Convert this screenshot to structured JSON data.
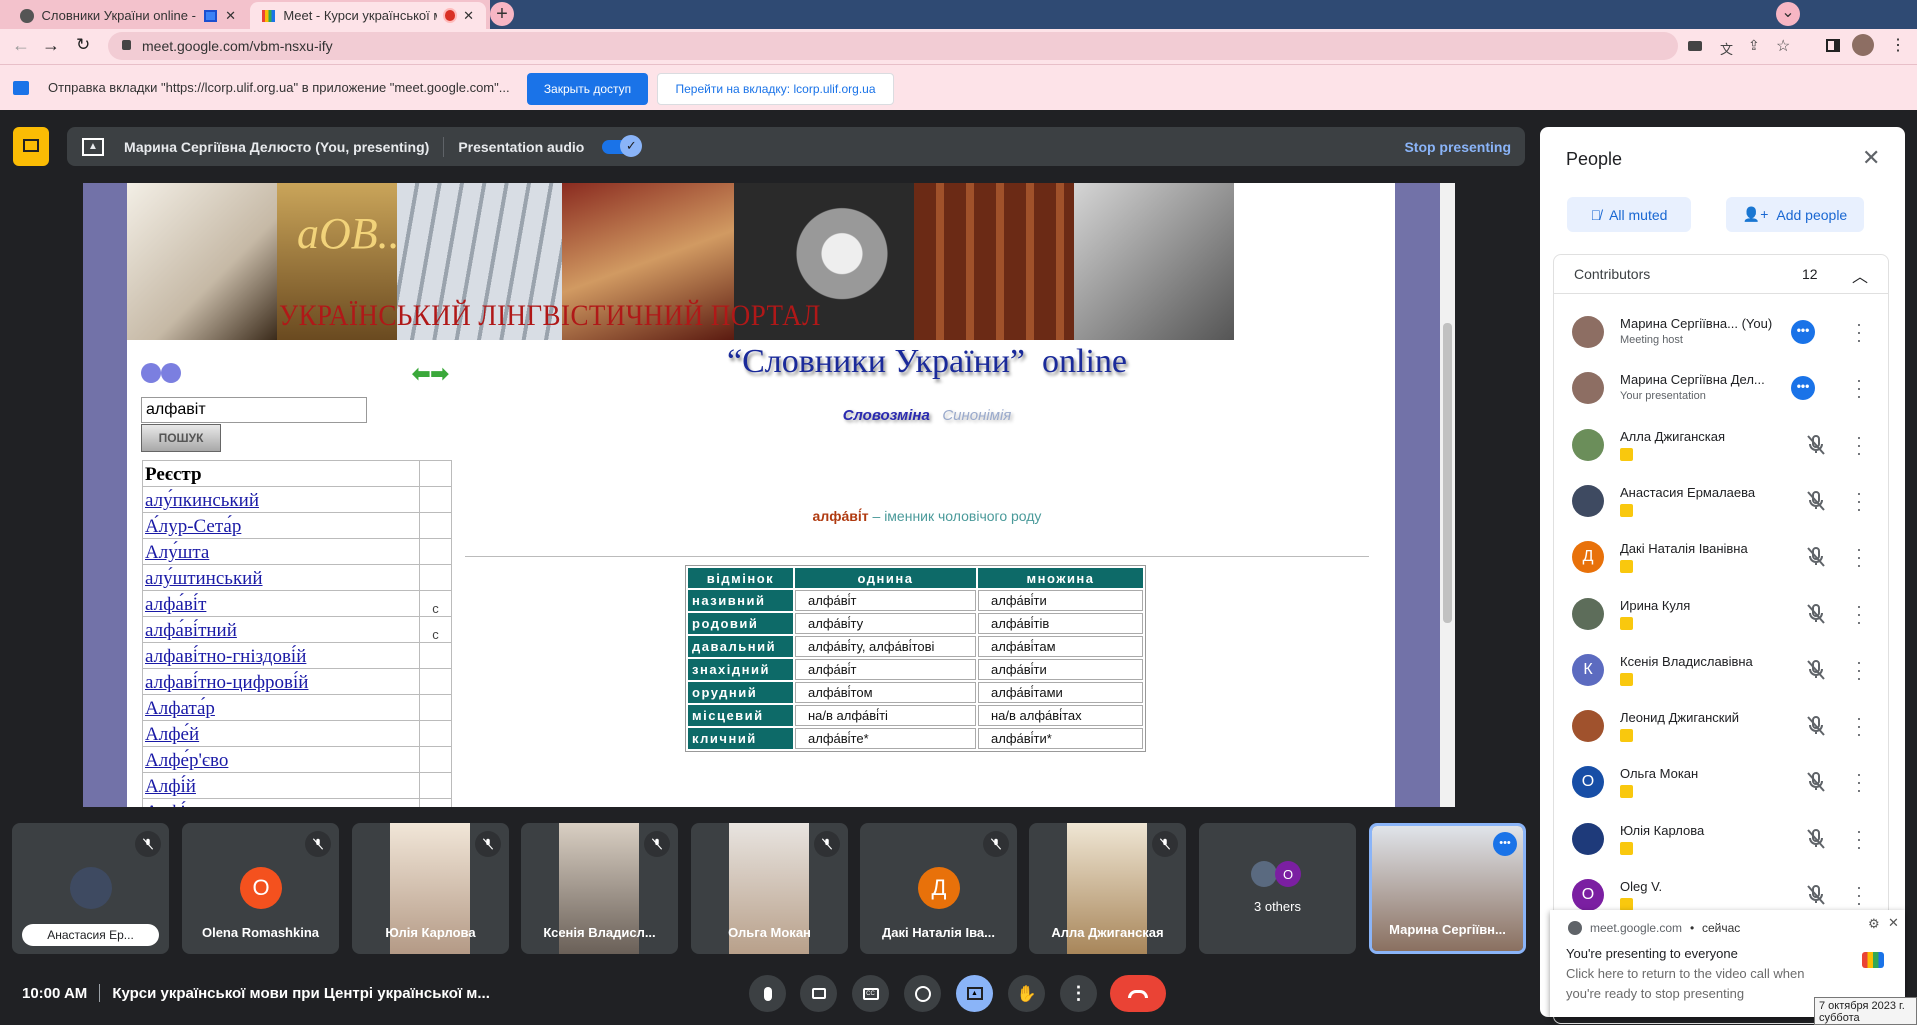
{
  "browser": {
    "tabs": [
      {
        "title": "Словники України online - У",
        "active": false
      },
      {
        "title": "Meet - Курси української мо",
        "active": true
      }
    ],
    "url": "meet.google.com/vbm-nsxu-ify",
    "infobar": {
      "text": "Отправка вкладки \"https://lcorp.ulif.org.ua\" в приложение \"meet.google.com\"...",
      "stop_button": "Закрыть доступ",
      "switch_button": "Перейти на вкладку: lcorp.ulif.org.ua"
    }
  },
  "presenting_bar": {
    "presenter": "Марина Сергіївна Делюсто (You, presenting)",
    "audio_label": "Presentation audio",
    "audio_on": true,
    "stop": "Stop presenting"
  },
  "shared_page": {
    "banner_title": "УКРАЇНСЬКИЙ ЛІНГВІСТИЧНИЙ ПОРТАЛ",
    "banner_logo": "аОВ...",
    "site_title_quoted": "“Словники України”",
    "site_title_suffix": "online",
    "search_value": "алфавіт",
    "search_button": "ПОШУК",
    "tabs": [
      "Словозміна",
      "Синонімія"
    ],
    "headword": "алфа́ві́т",
    "definition": " – іменник чоловічого роду",
    "registry": {
      "header": "Реєстр",
      "rows": [
        {
          "word": "алу́пкинський",
          "mark": ""
        },
        {
          "word": "А́лур-Сета́р",
          "mark": ""
        },
        {
          "word": "Алу́шта",
          "mark": ""
        },
        {
          "word": "алу́штинський",
          "mark": ""
        },
        {
          "word": "алфа́ві́т",
          "mark": "с"
        },
        {
          "word": "алфа́ві́тний",
          "mark": "с"
        },
        {
          "word": "алфаві́тно-гніздові́й",
          "mark": ""
        },
        {
          "word": "алфаві́тно-цифрові́й",
          "mark": ""
        },
        {
          "word": "Алфата́р",
          "mark": ""
        },
        {
          "word": "Алфе́й",
          "mark": ""
        },
        {
          "word": "Алфе́р'єво",
          "mark": ""
        },
        {
          "word": "Алфі́й",
          "mark": ""
        },
        {
          "word": "Алфі́...",
          "mark": ""
        }
      ]
    },
    "declension": {
      "headers": [
        "відмінок",
        "однина",
        "множина"
      ],
      "rows": [
        [
          "називний",
          "алфа́ві́т",
          "алфа́ві́ти"
        ],
        [
          "родовий",
          "алфа́ві́ту",
          "алфа́ві́тів"
        ],
        [
          "давальний",
          "алфа́ві́ту, алфа́ві́тові",
          "алфа́ві́там"
        ],
        [
          "знахідний",
          "алфа́ві́т",
          "алфа́ві́ти"
        ],
        [
          "орудний",
          "алфа́ві́том",
          "алфа́ві́тами"
        ],
        [
          "місцевий",
          "на/в алфа́ві́ті",
          "на/в алфа́ві́тах"
        ],
        [
          "кличний",
          "алфа́ві́те*",
          "алфа́ві́ти*"
        ]
      ]
    }
  },
  "people": {
    "title": "People",
    "all_muted": "All muted",
    "add_people": "Add people",
    "section": "Contributors",
    "count": "12",
    "list": [
      {
        "name": "Марина Сергіївна... (You)",
        "sub": "Meeting host",
        "initial": "",
        "color": "#8d6e63",
        "presenting": false,
        "more": true
      },
      {
        "name": "Марина Сергіївна Дел...",
        "sub": "Your presentation",
        "initial": "",
        "color": "#8d6e63",
        "presenting": false,
        "more": true
      },
      {
        "name": "Алла Джиганская",
        "sub": "",
        "initial": "",
        "color": "#6b8e5a",
        "presenting": true
      },
      {
        "name": "Анастасия Ермалаева",
        "sub": "",
        "initial": "",
        "color": "#3e4a61",
        "presenting": true
      },
      {
        "name": "Дакі Наталія Іванівна",
        "sub": "",
        "initial": "Д",
        "color": "#e8710a",
        "presenting": true
      },
      {
        "name": "Ирина Куля",
        "sub": "",
        "initial": "",
        "color": "#5d6d5a",
        "presenting": true
      },
      {
        "name": "Ксенія Владиславівна",
        "sub": "",
        "initial": "К",
        "color": "#5c6bc0",
        "presenting": true
      },
      {
        "name": "Леонид Джиганский",
        "sub": "",
        "initial": "",
        "color": "#a0522d",
        "presenting": true
      },
      {
        "name": "Ольга Мокан",
        "sub": "",
        "initial": "О",
        "color": "#174ea6",
        "presenting": true
      },
      {
        "name": "Юлія Карлова",
        "sub": "",
        "initial": "",
        "color": "#1e3a7a",
        "presenting": true
      },
      {
        "name": "Oleg V.",
        "sub": "",
        "initial": "O",
        "color": "#7b1fa2",
        "presenting": true
      }
    ]
  },
  "tiles": [
    {
      "name": "Анастасия Ер...",
      "initial": "",
      "color": "#3e4a61",
      "video": false
    },
    {
      "name": "Olena Romashkina",
      "initial": "O",
      "color": "#f4511e",
      "video": false
    },
    {
      "name": "Юлія Карлова",
      "initial": "",
      "color": "",
      "video": true
    },
    {
      "name": "Ксенія Владисл...",
      "initial": "",
      "color": "",
      "video": true
    },
    {
      "name": "Ольга Мокан",
      "initial": "",
      "color": "",
      "video": true
    },
    {
      "name": "Дакі Наталія Іва...",
      "initial": "Д",
      "color": "#e8710a",
      "video": false
    },
    {
      "name": "Алла Джиганская",
      "initial": "",
      "color": "",
      "video": true
    },
    {
      "name": "3 others",
      "initial": "O",
      "color": "#7b1fa2",
      "video": false
    },
    {
      "name": "Марина Сергіївн...",
      "initial": "",
      "color": "",
      "video": true
    }
  ],
  "bottom": {
    "time": "10:00 AM",
    "meeting_title": "Курси української мови при Центрі української м..."
  },
  "notification": {
    "origin": "meet.google.com",
    "when": "сейчас",
    "title": "You're presenting to everyone",
    "body1": "Click here to return to the video call when",
    "body2": "you're ready to stop presenting"
  },
  "tooltip": {
    "date": "7 октября 2023 г.",
    "day": "суббота"
  },
  "colors": {
    "accent": "#1a73e8",
    "teal": "#0d6a68",
    "end_call": "#ea4335"
  }
}
